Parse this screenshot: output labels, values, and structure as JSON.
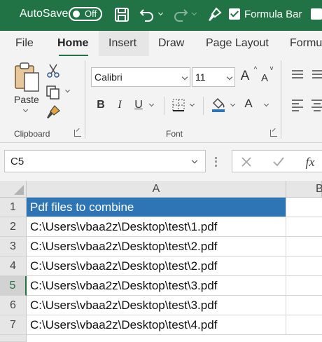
{
  "titlebar": {
    "autosave_label": "AutoSave",
    "autosave_state": "Off",
    "formula_bar_label": "Formula Bar",
    "bg_color": "#217346"
  },
  "tabs": [
    "File",
    "Home",
    "Insert",
    "Draw",
    "Page Layout",
    "Formu"
  ],
  "ribbon": {
    "paste_label": "Paste",
    "clipboard_label": "Clipboard",
    "font_label": "Font",
    "font_name": "Calibri",
    "font_size": "11",
    "grow_font": "A",
    "shrink_font": "A",
    "bold": "B",
    "italic": "I",
    "underline": "U",
    "font_color_glyph": "A"
  },
  "formula_bar": {
    "name_box": "C5",
    "fx": "fx"
  },
  "grid": {
    "columns": [
      "A",
      "B"
    ],
    "rows": [
      {
        "num": "1",
        "value": "Pdf files to combine",
        "header": true
      },
      {
        "num": "2",
        "value": "C:\\Users\\vbaa2z\\Desktop\\test\\1.pdf"
      },
      {
        "num": "3",
        "value": "C:\\Users\\vbaa2z\\Desktop\\test\\2.pdf"
      },
      {
        "num": "4",
        "value": "C:\\Users\\vbaa2z\\Desktop\\test\\2.pdf"
      },
      {
        "num": "5",
        "value": "C:\\Users\\vbaa2z\\Desktop\\test\\3.pdf",
        "selected": true
      },
      {
        "num": "6",
        "value": "C:\\Users\\vbaa2z\\Desktop\\test\\3.pdf"
      },
      {
        "num": "7",
        "value": "C:\\Users\\vbaa2z\\Desktop\\test\\4.pdf"
      }
    ],
    "header_fill": "#2e75b6"
  }
}
